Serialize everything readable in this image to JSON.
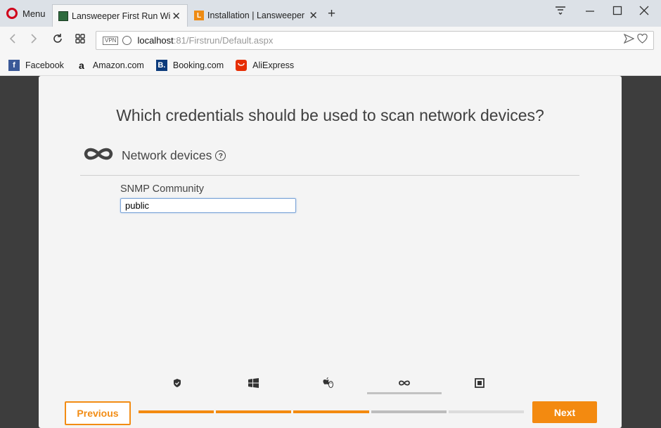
{
  "browser": {
    "menu_label": "Menu",
    "tabs": [
      {
        "title": "Lansweeper First Run Wiza",
        "active": true
      },
      {
        "title": "Installation | Lansweeper I",
        "active": false
      }
    ],
    "address": {
      "vpn_badge": "VPN",
      "host": "localhost",
      "rest": ":81/Firstrun/Default.aspx"
    },
    "bookmarks": [
      {
        "label": "Facebook",
        "icon": "facebook-icon",
        "glyph": "f"
      },
      {
        "label": "Amazon.com",
        "icon": "amazon-icon",
        "glyph": "a"
      },
      {
        "label": "Booking.com",
        "icon": "booking-icon",
        "glyph": "B."
      },
      {
        "label": "AliExpress",
        "icon": "aliexpress-icon",
        "glyph": ""
      }
    ]
  },
  "wizard": {
    "question": "Which credentials should be used to scan network devices?",
    "section_label": "Network devices",
    "section_help": "?",
    "field_label": "SNMP Community",
    "field_value": "public",
    "steps": [
      {
        "icon": "shield-icon"
      },
      {
        "icon": "windows-icon"
      },
      {
        "icon": "apple-linux-icon"
      },
      {
        "icon": "infinity-icon",
        "current": true
      },
      {
        "icon": "square-icon"
      }
    ],
    "progress_segments": [
      {
        "state": "done"
      },
      {
        "state": "done"
      },
      {
        "state": "done"
      },
      {
        "state": "current"
      },
      {
        "state": "pending"
      }
    ],
    "previous_label": "Previous",
    "next_label": "Next",
    "colors": {
      "accent": "#f38a10",
      "segment_current": "#bdbdbd",
      "segment_pending": "#dcdcdc"
    }
  }
}
